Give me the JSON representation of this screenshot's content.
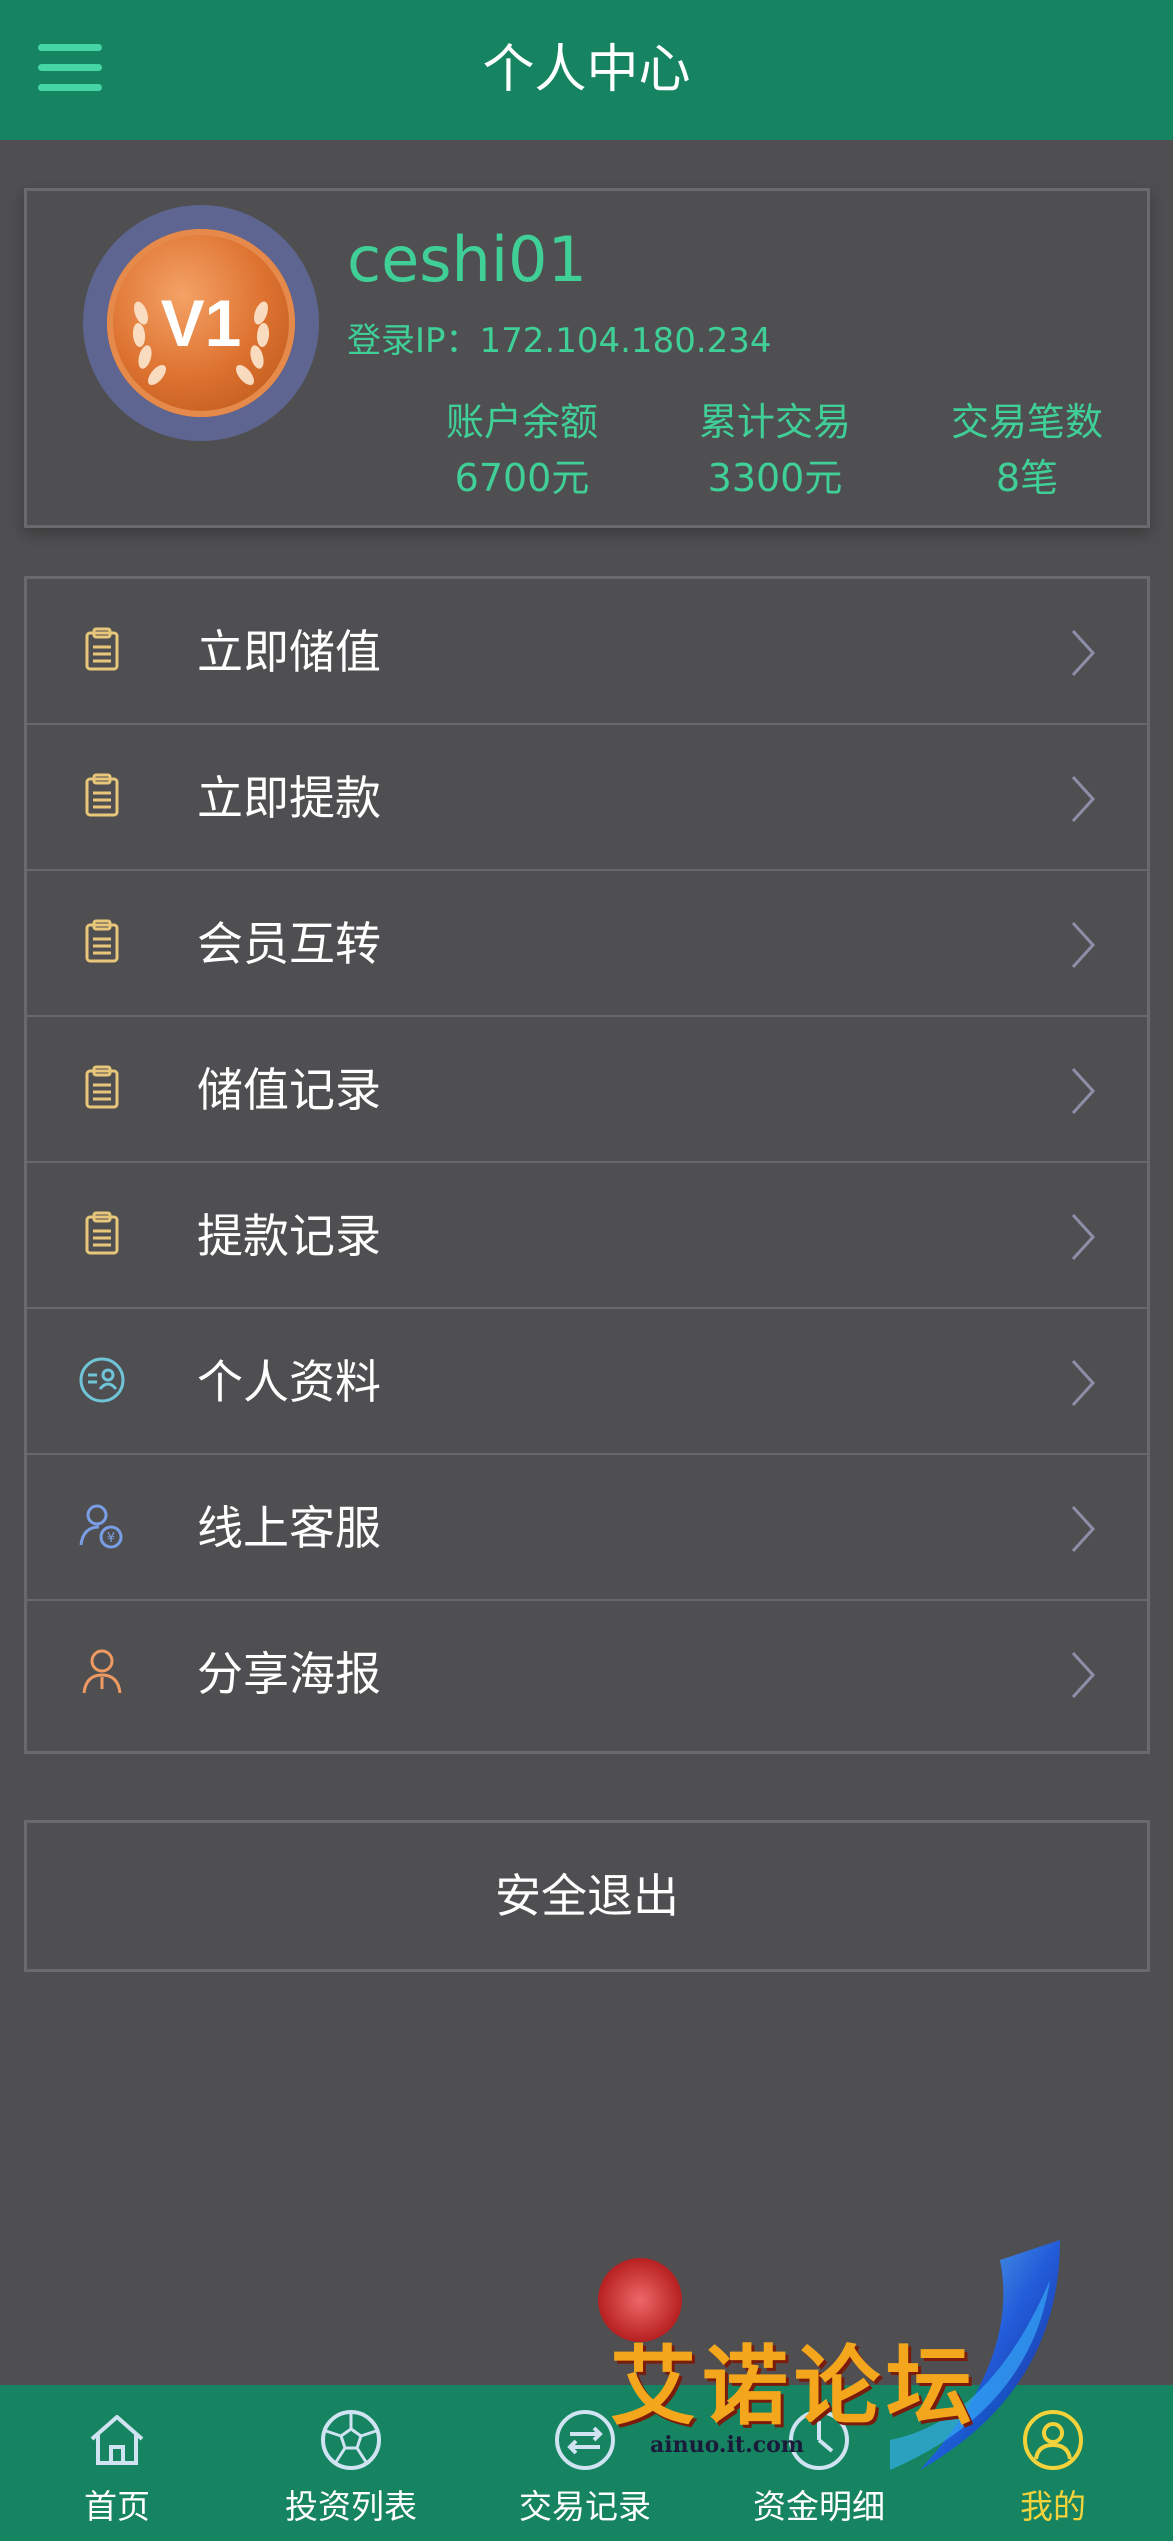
{
  "header": {
    "title": "个人中心",
    "menu_icon": "hamburger-menu-icon"
  },
  "profile": {
    "level": "V1",
    "username": "ceshi01",
    "login_ip": "登录IP：172.104.180.234",
    "stats": [
      {
        "label": "账户余额",
        "value": "6700元"
      },
      {
        "label": "累计交易",
        "value": "3300元"
      },
      {
        "label": "交易笔数",
        "value": "8笔"
      }
    ]
  },
  "menu": {
    "items": [
      {
        "label": "立即储值",
        "icon": "clipboard-icon"
      },
      {
        "label": "立即提款",
        "icon": "clipboard-icon"
      },
      {
        "label": "会员互转",
        "icon": "clipboard-icon"
      },
      {
        "label": "储值记录",
        "icon": "clipboard-icon"
      },
      {
        "label": "提款记录",
        "icon": "clipboard-icon"
      },
      {
        "label": "个人资料",
        "icon": "profile-card-icon"
      },
      {
        "label": "线上客服",
        "icon": "customer-service-icon"
      },
      {
        "label": "分享海报",
        "icon": "user-share-icon"
      }
    ]
  },
  "logout_label": "安全退出",
  "bottom_nav": {
    "items": [
      {
        "label": "首页",
        "icon": "home-icon",
        "active": false
      },
      {
        "label": "投资列表",
        "icon": "soccer-ball-icon",
        "active": false
      },
      {
        "label": "交易记录",
        "icon": "exchange-icon",
        "active": false
      },
      {
        "label": "资金明细",
        "icon": "clock-icon",
        "active": false
      },
      {
        "label": "我的",
        "icon": "user-icon",
        "active": true
      }
    ]
  },
  "watermark": {
    "text": "艾诺论坛",
    "url": "ainuo.it.com"
  },
  "colors": {
    "header_bg": "#168460",
    "page_bg": "#4f4f51",
    "accent_green": "#3fcf97",
    "active_nav": "#f3d23c"
  }
}
